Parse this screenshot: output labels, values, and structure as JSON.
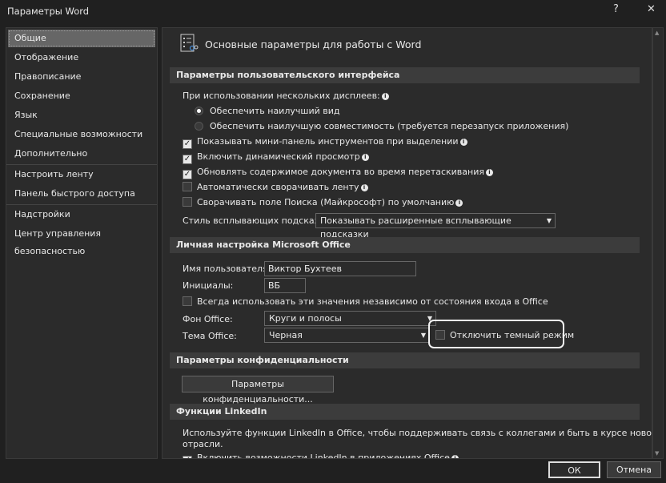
{
  "window": {
    "title": "Параметры Word",
    "help": "?",
    "close": "✕"
  },
  "sidebar": {
    "items": [
      {
        "label": "Общие",
        "selected": true
      },
      {
        "label": "Отображение"
      },
      {
        "label": "Правописание"
      },
      {
        "label": "Сохранение"
      },
      {
        "label": "Язык"
      },
      {
        "label": "Специальные возможности"
      },
      {
        "label": "Дополнительно"
      },
      {
        "label": "Настроить ленту"
      },
      {
        "label": "Панель быстрого доступа"
      },
      {
        "label": "Надстройки"
      },
      {
        "label": "Центр управления безопасностью"
      }
    ]
  },
  "main": {
    "heading": "Основные параметры для работы с Word",
    "ui_section": {
      "title": "Параметры пользовательского интерфейса",
      "multi_display_label": "При использовании нескольких дисплеев:",
      "radio_best_view": "Обеспечить наилучший вид",
      "radio_compat": "Обеспечить наилучшую совместимость (требуется перезапуск приложения)",
      "cb_minibar": "Показывать мини-панель инструментов при выделении",
      "cb_live_preview": "Включить динамический просмотр",
      "cb_update_drag": "Обновлять содержимое документа во время перетаскивания",
      "cb_collapse_ribbon": "Автоматически сворачивать ленту",
      "cb_collapse_search": "Сворачивать поле Поиска (Майкрософт) по умолчанию",
      "tooltip_label": "Стиль всплывающих подсказок:",
      "tooltip_value": "Показывать расширенные всплывающие подсказки"
    },
    "personal_section": {
      "title": "Личная настройка Microsoft Office",
      "username_label": "Имя пользователя:",
      "username_value": "Виктор Бухтеев",
      "initials_label": "Инициалы:",
      "initials_value": "ВБ",
      "cb_always": "Всегда использовать эти значения независимо от состояния входа в Office",
      "background_label": "Фон Office:",
      "background_value": "Круги и полосы",
      "theme_label": "Тема Office:",
      "theme_value": "Черная",
      "cb_dark_off": "Отключить темный режим"
    },
    "privacy_section": {
      "title": "Параметры конфиденциальности",
      "button": "Параметры конфиденциальности..."
    },
    "linkedin_section": {
      "title": "Функции LinkedIn",
      "text1": "Используйте функции LinkedIn в Office, чтобы поддерживать связь с коллегами и быть в курсе новостей вашей",
      "text2": "отрасли.",
      "cb_enable": "Включить возможности LinkedIn в приложениях Office"
    }
  },
  "footer": {
    "ok": "ОК",
    "cancel": "Отмена"
  }
}
